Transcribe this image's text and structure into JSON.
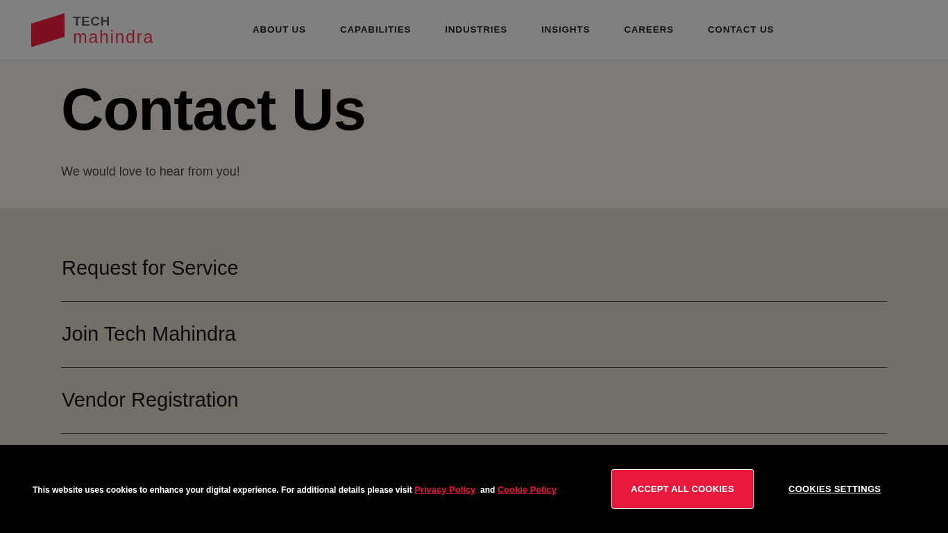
{
  "header": {
    "logo": {
      "top": "TECH",
      "bottom": "mahindra"
    },
    "nav": [
      {
        "label": "ABOUT US"
      },
      {
        "label": "CAPABILITIES"
      },
      {
        "label": "INDUSTRIES"
      },
      {
        "label": "INSIGHTS"
      },
      {
        "label": "CAREERS"
      },
      {
        "label": "CONTACT US"
      }
    ]
  },
  "hero": {
    "title": "Contact Us",
    "subtitle": "We would love to hear from you!"
  },
  "sections": [
    {
      "label": "Request for Service"
    },
    {
      "label": "Join Tech Mahindra"
    },
    {
      "label": "Vendor Registration"
    }
  ],
  "cookie_banner": {
    "message": "This website uses cookies to enhance your digital experience. For additional details please visit",
    "privacy_link": "Privacy Policy",
    "conjunction": "and",
    "cookie_link": "Cookie Policy",
    "accept_button": "ACCEPT ALL COOKIES",
    "settings_link": "COOKIES SETTINGS"
  }
}
